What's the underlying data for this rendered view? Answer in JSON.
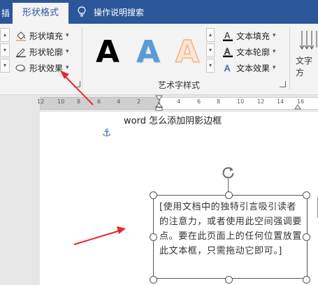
{
  "ribbon": {
    "tab_left_partial": "插",
    "active_tab": "形状格式",
    "search_tab": "操作说明搜索",
    "shape_commands": [
      {
        "label": "形状填充"
      },
      {
        "label": "形状轮廓"
      },
      {
        "label": "形状效果"
      }
    ],
    "wordart_sample": "A",
    "wordart_group_label": "艺术字样式",
    "text_commands": [
      {
        "label": "文本填充"
      },
      {
        "label": "文本轮廓"
      },
      {
        "label": "文本效果"
      }
    ],
    "text_direction_partial": "文字方"
  },
  "ruler": {
    "ticks": [
      "12",
      "10",
      "8",
      "6",
      "4",
      "2",
      "2",
      "4",
      "6",
      "8",
      "10",
      "12",
      "14",
      "16"
    ]
  },
  "document": {
    "title": "word 怎么添加阴影边框",
    "textbox_text": "[使用文档中的独特引言吸引读者的注意力，或者使用此空间强调要点。要在此页面上的任何位置放置此文本框，只需拖动它即可。]"
  },
  "colors": {
    "ribbon_tab_bar": "#2b579a",
    "ribbon_body": "#f3f3f3",
    "annotation_arrow": "#e8262d",
    "wordart_blue": "#5b9bd5",
    "wordart_orange": "#f4b183"
  }
}
